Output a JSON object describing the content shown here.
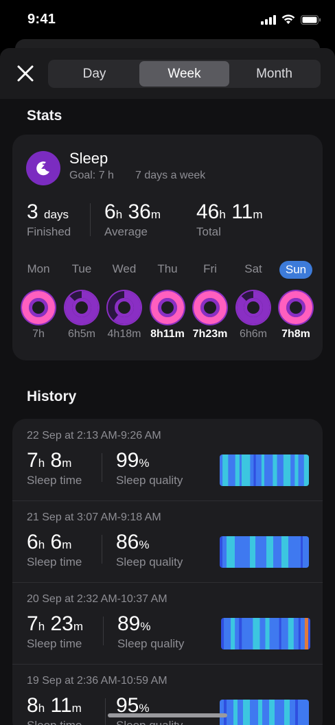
{
  "status_bar": {
    "time": "9:41"
  },
  "tabs": [
    {
      "label": "Day",
      "active": false
    },
    {
      "label": "Week",
      "active": true
    },
    {
      "label": "Month",
      "active": false
    }
  ],
  "stats_section": {
    "title": "Stats"
  },
  "sleep": {
    "title": "Sleep",
    "goal": "Goal: 7 h",
    "frequency": "7 days a week",
    "icon": "moon-z-icon",
    "accent": "#7b2cc0"
  },
  "summary": [
    {
      "num": "3",
      "unit": "days",
      "label": "Finished"
    },
    {
      "h": "6",
      "m": "36",
      "label": "Average"
    },
    {
      "h": "46",
      "m": "11",
      "label": "Total"
    }
  ],
  "week": [
    {
      "day": "Mon",
      "value": "7h",
      "fraction": 1.0,
      "today": false,
      "bold": false
    },
    {
      "day": "Tue",
      "value": "6h5m",
      "fraction": 0.87,
      "today": false,
      "bold": false
    },
    {
      "day": "Wed",
      "value": "4h18m",
      "fraction": 0.61,
      "today": false,
      "bold": false
    },
    {
      "day": "Thu",
      "value": "8h11m",
      "fraction": 1.0,
      "today": false,
      "bold": true
    },
    {
      "day": "Fri",
      "value": "7h23m",
      "fraction": 1.0,
      "today": false,
      "bold": true
    },
    {
      "day": "Sat",
      "value": "6h6m",
      "fraction": 0.87,
      "today": false,
      "bold": false
    },
    {
      "day": "Sun",
      "value": "7h8m",
      "fraction": 1.0,
      "today": true,
      "bold": true
    }
  ],
  "history_section": {
    "title": "History"
  },
  "history": [
    {
      "date": "22 Sep at 2:13 AM-9:26 AM",
      "h": "7",
      "m": "8",
      "time_label": "Sleep time",
      "quality": "99",
      "quality_label": "Sleep quality"
    },
    {
      "date": "21 Sep at 3:07 AM-9:18 AM",
      "h": "6",
      "m": "6",
      "time_label": "Sleep time",
      "quality": "86",
      "quality_label": "Sleep quality"
    },
    {
      "date": "20 Sep at 2:32 AM-10:37 AM",
      "h": "7",
      "m": "23",
      "time_label": "Sleep time",
      "quality": "89",
      "quality_label": "Sleep quality"
    },
    {
      "date": "19 Sep at 2:36 AM-10:59 AM",
      "h": "8",
      "m": "11",
      "time_label": "Sleep time",
      "quality": "95",
      "quality_label": "Sleep quality"
    }
  ],
  "colors": {
    "ring_full": "#ff5fbf",
    "ring_track": "#8a2fc4",
    "today_badge": "#3d7bd9",
    "deep": "#2f4fe0",
    "light": "#3f79f0",
    "rem": "#3cc6e0",
    "awake": "#e07a3c"
  }
}
